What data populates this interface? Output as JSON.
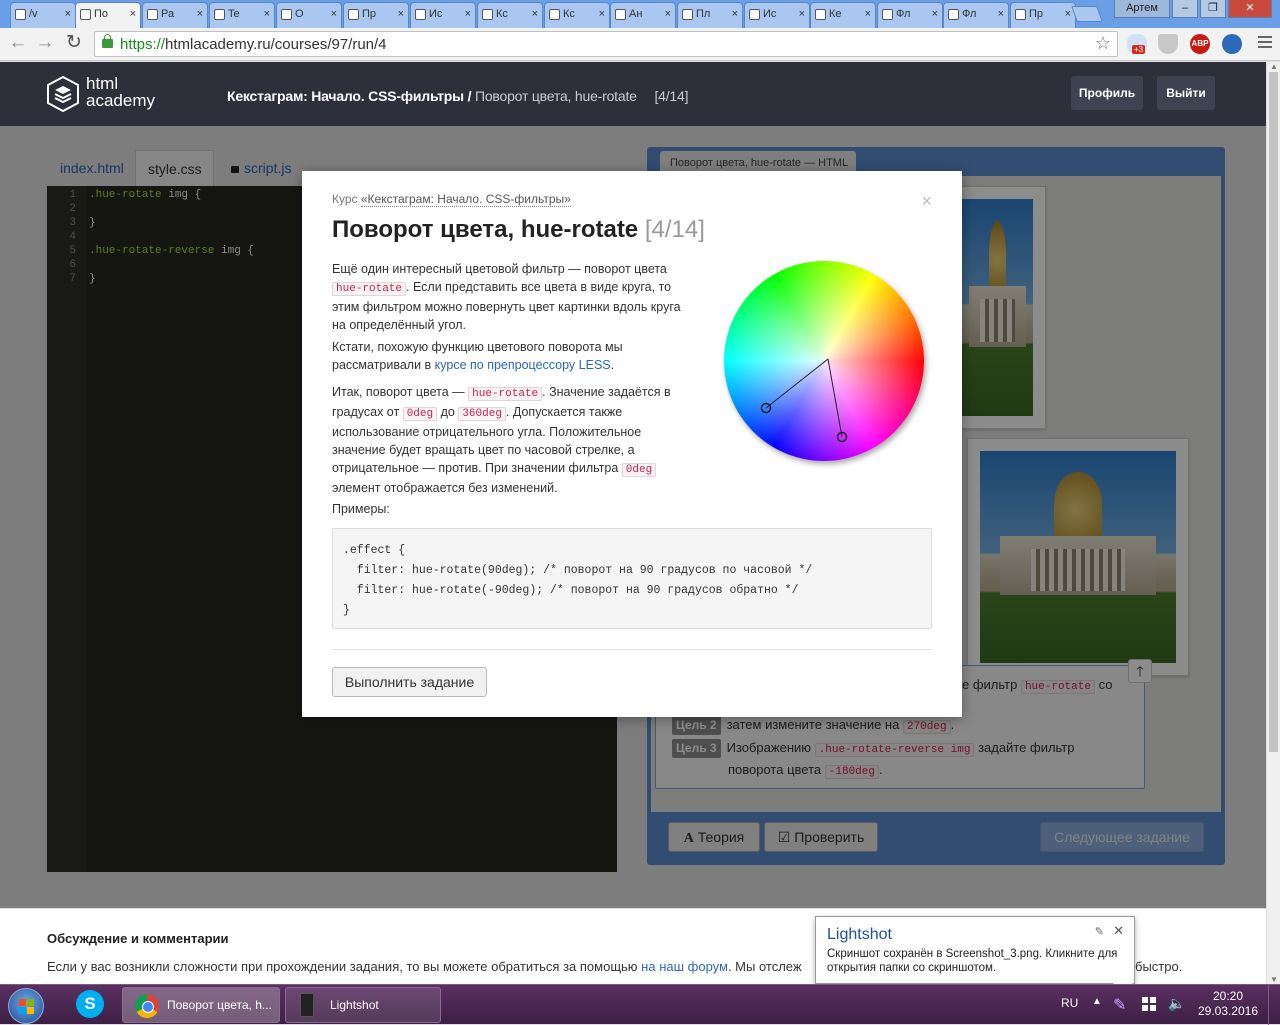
{
  "browser": {
    "tabs": [
      {
        "label": "/v",
        "icon": "flash-icon"
      },
      {
        "label": "По",
        "icon": "page-icon"
      },
      {
        "label": "Ра",
        "icon": "page-icon"
      },
      {
        "label": "Te",
        "icon": "page-icon"
      },
      {
        "label": "О",
        "icon": "page-icon"
      },
      {
        "label": "Пр",
        "icon": "page-icon"
      },
      {
        "label": "Ис",
        "icon": "page-icon"
      },
      {
        "label": "Кс",
        "icon": "page-icon"
      },
      {
        "label": "Кс",
        "icon": "page-icon"
      },
      {
        "label": "Ан",
        "icon": "page-icon"
      },
      {
        "label": "Пл",
        "icon": "page-icon"
      },
      {
        "label": "Ис",
        "icon": "page-icon"
      },
      {
        "label": "Ке",
        "icon": "page-icon"
      },
      {
        "label": "Фл",
        "icon": "page-icon"
      },
      {
        "label": "Фл",
        "icon": "page-icon"
      },
      {
        "label": "Пр",
        "icon": "page-icon"
      }
    ],
    "active_tab_index": 1,
    "window_user": "Артем",
    "url_scheme": "https://",
    "url_rest": "htmlacademy.ru/courses/97/run/4",
    "extension_badge": "+3",
    "abp_label": "ABP"
  },
  "site": {
    "logo_line1": "html",
    "logo_line2": "academy",
    "breadcrumb_course": "Кекстаграм: Начало. CSS-фильтры /",
    "breadcrumb_current": "Поворот цвета, hue-rotate",
    "breadcrumb_count": "[4/14]",
    "profile_btn": "Профиль",
    "logout_btn": "Выйти"
  },
  "editor": {
    "tabs": {
      "index": "index.html",
      "style": "style.css",
      "script": "script.js"
    },
    "line_numbers": "1\n2\n3\n4\n5\n6\n7",
    "code_line1_selector": ".hue-rotate",
    "code_line1_rest": " img {",
    "code_line3": "}",
    "code_line5_selector": ".hue-rotate-reverse",
    "code_line5_rest": " img {",
    "code_line7": "}"
  },
  "preview": {
    "tab_label": "Поворот цвета, hue-rotate — HTML",
    "goal1_tail_a": "е фильтр",
    "goal1_code": "hue-rotate",
    "goal1_tail_b": "со",
    "goal2_label": "Цель 2",
    "goal2_text": "затем измените значение на",
    "goal2_code": "270deg",
    "goal2_end": ".",
    "goal3_label": "Цель 3",
    "goal3_text_a": "Изображению",
    "goal3_code_a": ".hue-rotate-reverse img",
    "goal3_text_b": "задайте фильтр",
    "goal3_text_c": "поворота цвета",
    "goal3_code_b": "-180deg",
    "goal3_end": ".",
    "scroll_top": "🡑",
    "theory_btn": "Теория",
    "theory_icon": "A",
    "check_btn": "Проверить",
    "check_icon": "☑",
    "next_btn": "Следующее задание"
  },
  "discussion": {
    "title": "Обсуждение и комментарии",
    "text_a": "Если у вас возникли сложности при прохождении задания, то вы можете обратиться за помощью",
    "link": "на наш форум",
    "text_b": ". Мы отслеж",
    "text_c": "быстро."
  },
  "modal": {
    "course_prefix": "Курс",
    "course_link": "«Кекстаграм: Начало. CSS-фильтры»",
    "close": "×",
    "title": "Поворот цвета, hue-rotate",
    "step": "[4/14]",
    "p1_a": "Ещё один интересный цветовой фильтр — поворот цвета",
    "p1_code": "hue-rotate",
    "p1_b": ". Если представить все цвета в виде круга, то этим фильтром можно повернуть цвет картинки вдоль круга на определённый угол.",
    "p2_a": "Кстати, похожую функцию цветового поворота мы рассматривали в",
    "p2_link": "курсе по препроцессору LESS",
    "p2_b": ".",
    "p3_a": "Итак, поворот цвета —",
    "p3_code1": "hue-rotate",
    "p3_b": ". Значение задаётся в градусах от",
    "p3_code2": "0deg",
    "p3_c": "до",
    "p3_code3": "360deg",
    "p3_d": ". Допускается также использование отрицательного угла. Положительное значение будет вращать цвет по часовой стрелке, а отрицательное — против. При значении фильтра",
    "p3_code4": "0deg",
    "p3_e": "элемент отображается без изменений.",
    "examples_label": "Примеры:",
    "code": ".effect {\n  filter: hue-rotate(90deg); /* поворот на 90 градусов по часовой */\n  filter: hue-rotate(-90deg); /* поворот на 90 градусов обратно */\n}",
    "run_btn": "Выполнить задание"
  },
  "lightshot": {
    "title": "Lightshot",
    "text": "Скриншот сохранён в Screenshot_3.png. Кликните для открытия папки со скриншотом.",
    "pin": "✎",
    "close": "✕"
  },
  "taskbar": {
    "skype": "S",
    "chrome_task": "Поворот цвета, h...",
    "lightshot_task": "Lightshot",
    "lang": "RU",
    "tray_arrow": "▲",
    "tray_pen": "✎",
    "tray_sound": "🔈",
    "time": "20:20",
    "date": "29.03.2016"
  },
  "colors": {
    "header": "#2d2f3a",
    "accent_link": "#2b66b9",
    "code_red": "#c7254e",
    "preview_frame": "#5b8bd0",
    "taskbar": "#3d1f45"
  }
}
